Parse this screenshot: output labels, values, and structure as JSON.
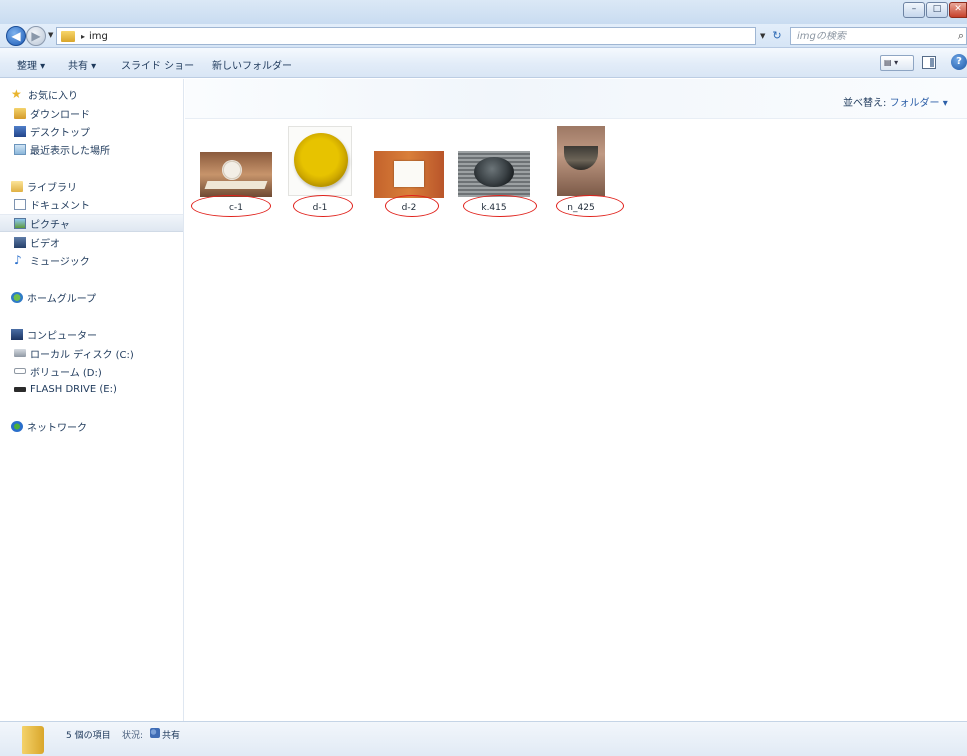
{
  "window": {
    "minimize_label": "–",
    "maximize_label": "□",
    "close_label": "✕"
  },
  "address": {
    "path": "img",
    "separator": "▸",
    "search_placeholder": "imgの検索"
  },
  "toolbar": {
    "organize": "整理 ▾",
    "share": "共有 ▾",
    "slideshow": "スライド ショー",
    "new_folder": "新しいフォルダー",
    "view_label": "▤ ▾",
    "help_label": "?"
  },
  "nav": {
    "favorites": {
      "header": "お気に入り",
      "items": [
        "ダウンロード",
        "デスクトップ",
        "最近表示した場所"
      ]
    },
    "libraries": {
      "header": "ライブラリ",
      "items": [
        "ドキュメント",
        "ピクチャ",
        "ビデオ",
        "ミュージック"
      ],
      "selected": "ピクチャ"
    },
    "homegroup": "ホームグループ",
    "computer": {
      "header": "コンピューター",
      "items": [
        "ローカル ディスク (C:)",
        "ボリューム (D:)",
        "FLASH DRIVE (E:)"
      ]
    },
    "network": "ネットワーク"
  },
  "content": {
    "arrange_label": "並べ替え:",
    "arrange_value": "フォルダー ▾",
    "files": [
      {
        "name": "c-1"
      },
      {
        "name": "d-1"
      },
      {
        "name": "d-2"
      },
      {
        "name": "k.415"
      },
      {
        "name": "n_425"
      }
    ]
  },
  "status": {
    "count": "5 個の項目",
    "label": "状況:",
    "value": "共有"
  },
  "colors": {
    "annotation_oval": "#e0211b",
    "link_blue": "#2c5fa8",
    "text": "#1e395b"
  }
}
